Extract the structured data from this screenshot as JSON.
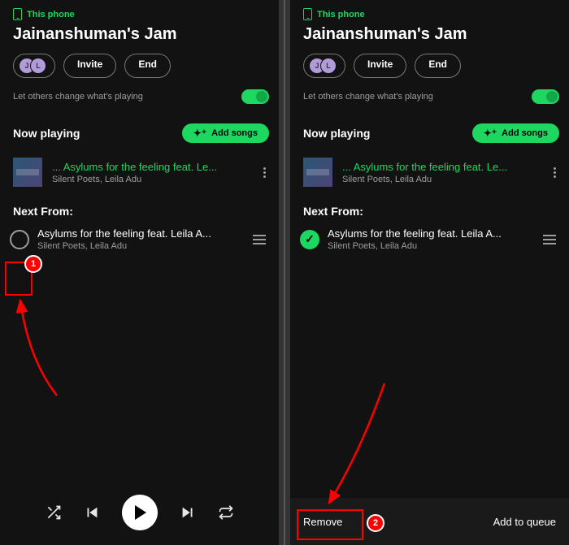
{
  "device_label": "This phone",
  "jam_title": "Jainanshuman's Jam",
  "avatars": [
    "J",
    "L"
  ],
  "invite_label": "Invite",
  "end_label": "End",
  "permission_text": "Let others change what's playing",
  "now_playing_label": "Now playing",
  "add_songs_label": "Add songs",
  "now_playing_track": {
    "title": "Asylums for the feeling feat. Le...",
    "artist": "Silent Poets, Leila Adu"
  },
  "next_from_label": "Next From:",
  "queue_track": {
    "title": "Asylums for the feeling feat. Leila A...",
    "artist": "Silent Poets, Leila Adu"
  },
  "selection_bar": {
    "remove": "Remove",
    "add_to_queue": "Add to queue"
  },
  "annotations": {
    "badge1": "1",
    "badge2": "2"
  }
}
